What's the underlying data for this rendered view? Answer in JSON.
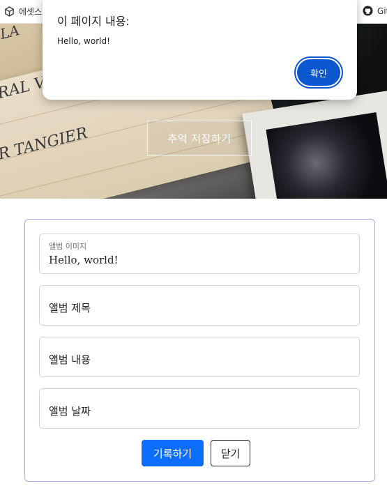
{
  "bookmarks": {
    "left_label": "에셋스",
    "right_label": "Git"
  },
  "hero": {
    "save_memory_label": "추억 저장하기",
    "script_lines": [
      "LA",
      "RAL V",
      "R TANGIER"
    ]
  },
  "dialog": {
    "title": "이 페이지 내용:",
    "message": "Hello, world!",
    "ok_label": "확인"
  },
  "form": {
    "album_image": {
      "label": "앨범 이미지",
      "value": "Hello, world!"
    },
    "album_title": {
      "placeholder": "앨범 제목"
    },
    "album_content": {
      "placeholder": "앨범 내용"
    },
    "album_date": {
      "placeholder": "앨범 날짜"
    },
    "record_label": "기록하기",
    "close_label": "닫기"
  },
  "colors": {
    "dialog_button": "#0b57d0",
    "primary_button": "#0d6efd",
    "card_border": "#a9a6f2"
  }
}
